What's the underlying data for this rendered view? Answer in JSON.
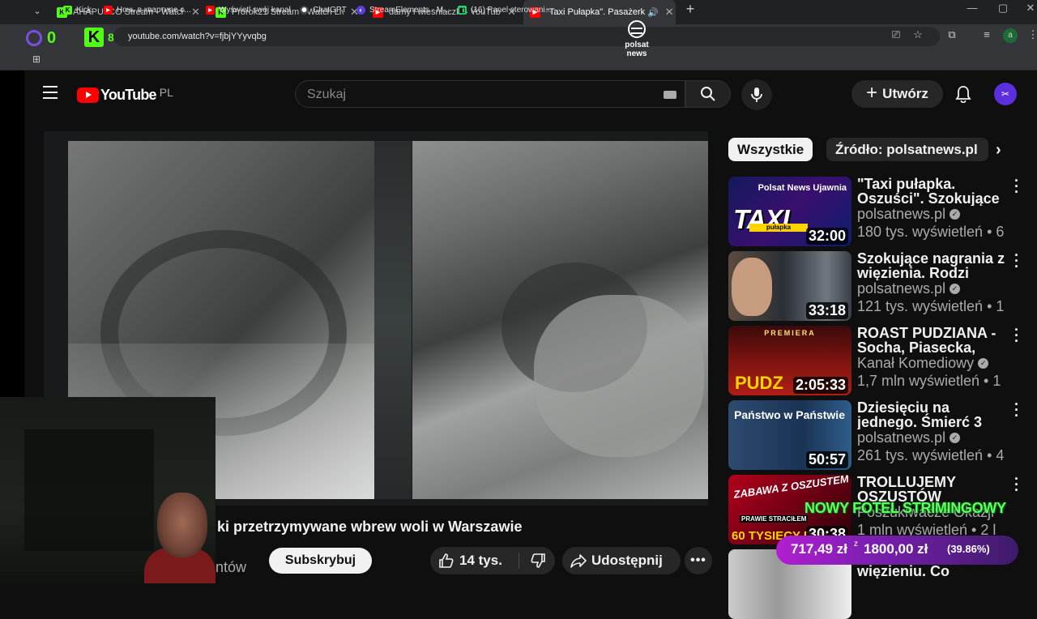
{
  "browser": {
    "tabs": [
      {
        "title": "AHAPULCO Stream - Watch Live",
        "active": false
      },
      {
        "title": "Prorok21 Stream - Watch Live o",
        "active": false
      },
      {
        "title": "damy i wiesniaczki - YouTube",
        "active": false
      },
      {
        "title": "\"Taxi Pułapka\". Pasażerki prz",
        "active": true
      }
    ],
    "url": "youtube.com/watch?v=fjbjYYyvqbg",
    "bookmarks": [
      {
        "label": "Kick",
        "icon": "kick-icon"
      },
      {
        "label": "Ночь в квартире с...",
        "icon": "youtube-icon"
      },
      {
        "label": "Wyświetl swój kanał",
        "icon": "youtube-icon"
      },
      {
        "label": "ChatGPT",
        "icon": "chatgpt-icon"
      },
      {
        "label": "StreamElements - M...",
        "icon": "streamelements-icon"
      },
      {
        "label": "(16) Panel sterowani...",
        "icon": "panel-icon"
      }
    ],
    "kick_overlay": {
      "left_count": "0",
      "right_count": "8"
    },
    "profile_initial": "a"
  },
  "youtube": {
    "logo_text": "YouTube",
    "country": "PL",
    "search_placeholder": "Szukaj",
    "create_label": "Utwórz"
  },
  "video": {
    "watermark": "polsat news",
    "title": "ki przetrzymywane wbrew woli w Warszawie",
    "subs_partial": "ntów",
    "subscribe": "Subskrybuj",
    "likes": "14 tys.",
    "share": "Udostępnij"
  },
  "sidebar": {
    "chips": [
      "Wszystkie",
      "Źródło: polsatnews.pl"
    ],
    "items": [
      {
        "title": "\"Taxi pułapka. Oszuści\". Szokujące",
        "channel": "polsatnews.pl",
        "verified": true,
        "meta": "180 tys. wyświetleń • 6",
        "duration": "32:00",
        "thumb_text": "TAXI",
        "thumb_sub": "pułapka",
        "thumb_header": "Polsat News Ujawnia"
      },
      {
        "title": "Szokujące nagrania z więzienia. Rodzi",
        "channel": "polsatnews.pl",
        "verified": true,
        "meta": "121 tys. wyświetleń • 1",
        "duration": "33:18"
      },
      {
        "title": "ROAST PUDZIANA - Socha, Piasecka,",
        "channel": "Kanał Komediowy",
        "verified": true,
        "meta": "1,7 mln wyświetleń • 1",
        "duration": "2:05:33",
        "thumb_top": "PREMIERA",
        "thumb_bottom": "PUDZ"
      },
      {
        "title": "Dziesięciu na jednego. Śmierć 3",
        "channel": "polsatnews.pl",
        "verified": true,
        "meta": "261 tys. wyświetleń • 4",
        "duration": "50:57",
        "thumb_label": "Państwo w Państwie"
      },
      {
        "title": "TROLLUJEMY OSZUSTÓW",
        "channel": "Poszukiwacze Okazji",
        "verified": false,
        "meta": "1 mln wyświetleń • 2 l",
        "duration": "30:38",
        "thumb_l1": "ZABAWA Z OSZUSTEM",
        "thumb_l2": "PRAWIE STRACIŁEM",
        "thumb_l3": "60 TYSIĘCY PLN"
      },
      {
        "title": "Tajemnicza śmierć w więzieniu. Co",
        "channel": "",
        "verified": false,
        "meta": "",
        "duration": ""
      }
    ]
  },
  "overlay": {
    "fotel_text": "NOWY FOTEL STRIMINGOWY",
    "goal_current": "717,49 zł",
    "goal_currency_small": "z",
    "goal_target": "1800,00 zł",
    "goal_percent": "(39.86%)",
    "goal_progress": 0.3986
  }
}
